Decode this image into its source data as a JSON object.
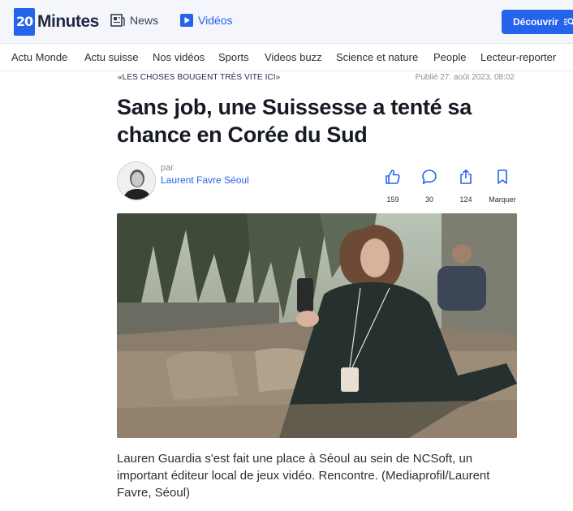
{
  "header": {
    "logo_number": "20",
    "logo_text": "Minutes",
    "news_label": "News",
    "videos_label": "Vidéos",
    "discover_label": "Découvrir",
    "accent": "#2563eb"
  },
  "sections": [
    "Actu Monde",
    "Actu suisse",
    "Nos vidéos",
    "Sports",
    "Videos buzz",
    "Science et nature",
    "People",
    "Lecteur-reporter"
  ],
  "article": {
    "kicker": "«LES CHOSES BOUGENT TRÈS VITE ICI»",
    "published": "Publié 27. août 2023, 08:02",
    "headline": "Sans job, une Suissesse a tenté sa chance en Corée du Sud",
    "by_label": "par",
    "author": "Laurent Favre Séoul",
    "caption": "Lauren Guardia s'est fait une place à Séoul au sein de NCSoft, un important éditeur local de jeux vidéo. Rencontre. (Mediaprofil/Laurent Favre, Séoul)"
  },
  "actions": {
    "likes": "159",
    "comments": "30",
    "shares": "124",
    "bookmark_label": "Marquer"
  },
  "icons": [
    "news-icon",
    "video-play-icon",
    "search-icon",
    "thumbs-up-icon",
    "comment-icon",
    "share-icon",
    "bookmark-icon"
  ]
}
